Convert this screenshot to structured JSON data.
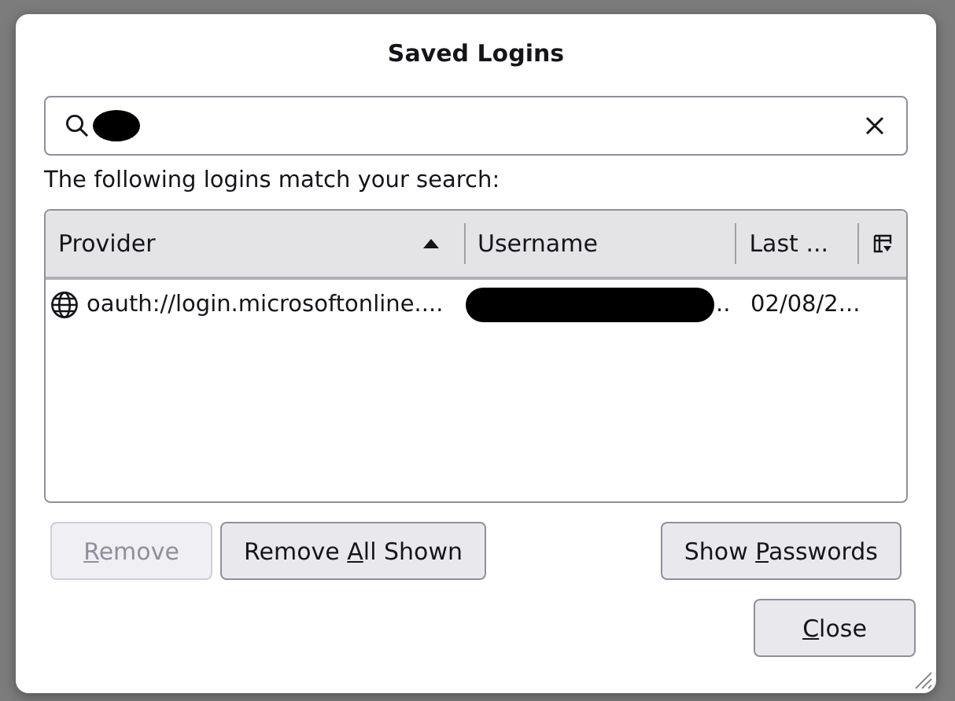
{
  "dialog": {
    "title": "Saved Logins",
    "search": {
      "redacted": true
    },
    "message": "The following logins match your search:",
    "table": {
      "columns": [
        {
          "label": "Provider",
          "sorted": true
        },
        {
          "label": "Username",
          "sorted": false
        },
        {
          "label": "Last ...",
          "sorted": false
        }
      ],
      "rows": [
        {
          "provider": "oauth://login.microsoftonline....",
          "username_tail": "..",
          "last": "02/08/2...",
          "selected": false
        }
      ]
    },
    "left_buttons": [
      {
        "key": "R",
        "after": "emove",
        "disabled": true
      },
      {
        "before": "Remove ",
        "key": "A",
        "after": "ll Shown",
        "disabled": false
      }
    ],
    "right_buttons": [
      {
        "before": "Show ",
        "key": "P",
        "after": "asswords",
        "disabled": false
      }
    ],
    "footer_buttons": [
      {
        "key": "C",
        "after": "lose",
        "disabled": false
      }
    ]
  }
}
